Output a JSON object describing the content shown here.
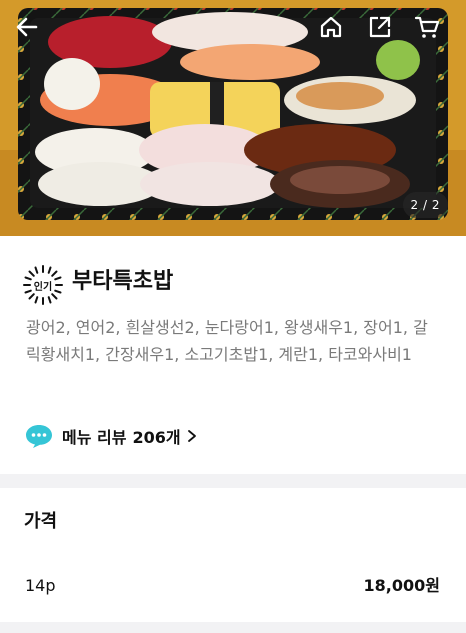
{
  "hero": {
    "image_counter": "2 / 2",
    "icons": [
      "back-arrow-icon",
      "home-icon",
      "share-icon",
      "cart-icon"
    ]
  },
  "menu": {
    "badge": "인기",
    "title": "부타특초밥",
    "description": "광어2, 연어2, 흰살생선2, 눈다랑어1, 왕생새우1, 장어1, 갈릭황새치1, 간장새우1, 소고기초밥1, 계란1, 타코와사비1",
    "review_label": "메뉴 리뷰",
    "review_count": "206개"
  },
  "price": {
    "heading": "가격",
    "option_name": "14p",
    "option_price": "18,000원"
  },
  "colors": {
    "hero_background": "#d49a2a",
    "review_icon": "#35c5d6",
    "page_background": "#f2f2f4"
  }
}
